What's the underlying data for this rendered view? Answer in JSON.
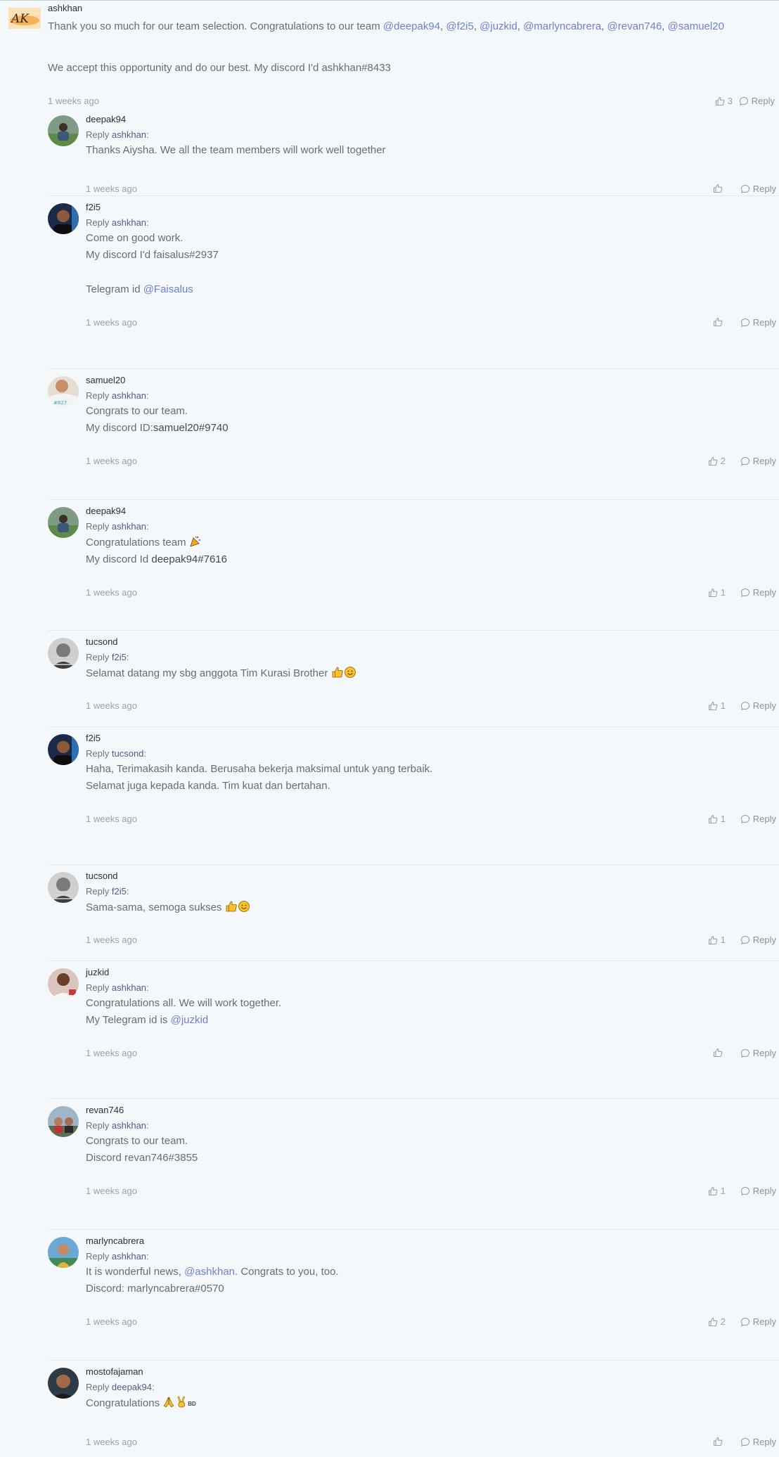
{
  "post": {
    "author": "ashkhan",
    "line1_prefix": "Thank you so much for our team selection. Congratulations to our team ",
    "mentions": [
      "@deepak94",
      "@f2i5",
      "@juzkid",
      "@marlyncabrera",
      "@revan746",
      "@samuel20"
    ],
    "line2": "We accept this opportunity and do our best. My discord I'd ashkhan#8433",
    "time": "1 weeks ago",
    "likes": "3",
    "reply_label": "Reply"
  },
  "reply_prefix": "Reply",
  "replies": [
    {
      "user": "deepak94",
      "to": "ashkhan",
      "lines": [
        "Thanks Aiysha. We all the team members will work well together"
      ],
      "time": "1 weeks ago",
      "likes": ""
    },
    {
      "user": "f2i5",
      "to": "ashkhan",
      "lines": [
        "Come on good work.",
        "My discord I'd faisalus#2937",
        "Telegram id "
      ],
      "mention": "@Faisalus",
      "time": "1 weeks ago",
      "likes": ""
    },
    {
      "user": "samuel20",
      "to": "ashkhan",
      "lines": [
        "Congrats to our team.",
        "My discord ID:",
        "samuel20#9740"
      ],
      "time": "1 weeks ago",
      "likes": "2"
    },
    {
      "user": "deepak94",
      "to": "ashkhan",
      "lines": [
        "Congratulations team ",
        "My discord Id ",
        "deepak94#7616"
      ],
      "time": "1 weeks ago",
      "likes": "1"
    },
    {
      "user": "tucsond",
      "to": "f2i5",
      "lines": [
        "Selamat datang my sbg anggota Tim Kurasi Brother "
      ],
      "time": "1 weeks ago",
      "likes": "1"
    },
    {
      "user": "f2i5",
      "to": "tucsond",
      "lines": [
        "Haha, Terimakasih kanda. Berusaha bekerja maksimal untuk yang terbaik.",
        "Selamat juga kepada kanda. Tim kuat dan bertahan."
      ],
      "time": "1 weeks ago",
      "likes": "1"
    },
    {
      "user": "tucsond",
      "to": "f2i5",
      "lines": [
        "Sama-sama, semoga sukses "
      ],
      "time": "1 weeks ago",
      "likes": "1"
    },
    {
      "user": "juzkid",
      "to": "ashkhan",
      "lines": [
        "Congratulations all. We will work together.",
        "My Telegram id is "
      ],
      "mention": "@juzkid",
      "time": "1 weeks ago",
      "likes": ""
    },
    {
      "user": "revan746",
      "to": "ashkhan",
      "lines": [
        "Congrats to our team.",
        "Discord revan746#3855"
      ],
      "time": "1 weeks ago",
      "likes": "1"
    },
    {
      "user": "marlyncabrera",
      "to": "ashkhan",
      "lines": [
        "It is wonderful news, ",
        ". Congrats to you, too.",
        "Discord: marlyncabrera#0570"
      ],
      "mention": "@ashkhan",
      "time": "1 weeks ago",
      "likes": "2"
    },
    {
      "user": "mostofajaman",
      "to": "deepak94",
      "lines": [
        "Congratulations "
      ],
      "badge": "BD",
      "time": "1 weeks ago",
      "likes": ""
    }
  ],
  "colors": {
    "mention": "#6f7fd1",
    "background": "#f5f8fb",
    "divider": "#e4e9ef"
  }
}
